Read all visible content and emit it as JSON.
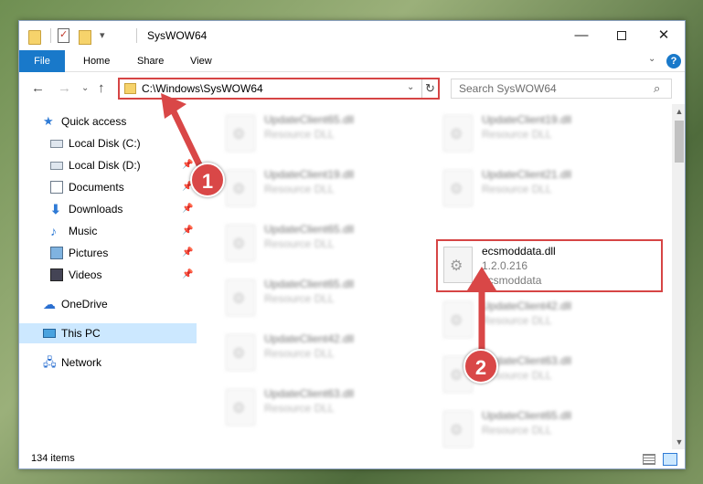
{
  "window": {
    "title": "SysWOW64",
    "quick_access_customize": "▾",
    "minimize": "—",
    "close": "✕"
  },
  "ribbon": {
    "tabs": [
      "File",
      "Home",
      "Share",
      "View"
    ],
    "collapse": "⌄",
    "help": "?"
  },
  "nav": {
    "back": "←",
    "forward": "→",
    "recent": "⌄",
    "up": "↑",
    "address": "C:\\Windows\\SysWOW64",
    "address_dropdown": "⌄",
    "refresh": "↻",
    "search_placeholder": "Search SysWOW64",
    "search_icon": "⌕"
  },
  "sidebar": {
    "items": [
      {
        "label": "Quick access",
        "icon": "star-icon",
        "pinned": false
      },
      {
        "label": "Local Disk (C:)",
        "icon": "drive-icon",
        "pinned": false
      },
      {
        "label": "Local Disk (D:)",
        "icon": "drive-icon",
        "pinned": true
      },
      {
        "label": "Documents",
        "icon": "documents-icon",
        "pinned": true
      },
      {
        "label": "Downloads",
        "icon": "downloads-icon",
        "pinned": true
      },
      {
        "label": "Music",
        "icon": "music-icon",
        "pinned": true
      },
      {
        "label": "Pictures",
        "icon": "pictures-icon",
        "pinned": true
      },
      {
        "label": "Videos",
        "icon": "videos-icon",
        "pinned": true
      },
      {
        "label": "OneDrive",
        "icon": "onedrive-icon",
        "pinned": false
      },
      {
        "label": "This PC",
        "icon": "this-pc-icon",
        "pinned": false,
        "selected": true
      },
      {
        "label": "Network",
        "icon": "network-icon",
        "pinned": false
      }
    ],
    "pin_glyph": "📌"
  },
  "files": {
    "col1": [
      {
        "name": "UpdateClient65.dll",
        "type": "Resource DLL"
      },
      {
        "name": "UpdateClient19.dll",
        "type": "Resource DLL"
      },
      {
        "name": "UpdateClient65.dll",
        "type": "Resource DLL"
      },
      {
        "name": "UpdateClient65.dll",
        "type": "Resource DLL"
      },
      {
        "name": "UpdateClient42.dll",
        "type": "Resource DLL"
      },
      {
        "name": "UpdateClient63.dll",
        "type": "Resource DLL"
      }
    ],
    "col2": [
      {
        "name": "UpdateClient19.dll",
        "type": "Resource DLL"
      },
      {
        "name": "UpdateClient21.dll",
        "type": "Resource DLL"
      },
      {
        "name": "ecsmoddata.dll",
        "version": "1.2.0.216",
        "description": "ecsmoddata",
        "highlighted": true
      },
      {
        "name": "UpdateClient42.dll",
        "type": "Resource DLL"
      },
      {
        "name": "UpdateClient63.dll",
        "type": "Resource DLL"
      },
      {
        "name": "UpdateClient65.dll",
        "type": "Resource DLL"
      }
    ]
  },
  "scrollbar": {
    "up": "▲",
    "down": "▼",
    "thumb_position_fraction": 0.0
  },
  "status": {
    "item_count": "134 items"
  },
  "annotations": {
    "step1": "1",
    "step2": "2",
    "color": "#d94747"
  },
  "colors": {
    "accent": "#1979ca",
    "selection": "#cce8ff",
    "highlight_border": "#d64545"
  }
}
